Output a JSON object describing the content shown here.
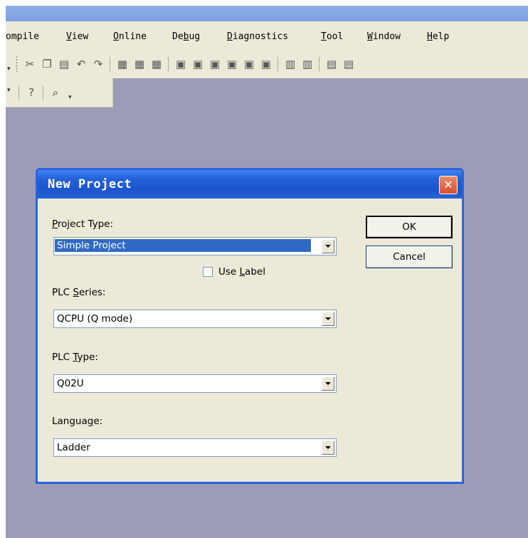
{
  "menubar": {
    "items": [
      {
        "pre": "",
        "mn": "",
        "post": "ompile"
      },
      {
        "pre": "",
        "mn": "V",
        "post": "iew"
      },
      {
        "pre": "",
        "mn": "O",
        "post": "nline"
      },
      {
        "pre": "De",
        "mn": "b",
        "post": "ug"
      },
      {
        "pre": "",
        "mn": "D",
        "post": "iagnostics"
      },
      {
        "pre": "",
        "mn": "T",
        "post": "ool"
      },
      {
        "pre": "",
        "mn": "W",
        "post": "indow"
      },
      {
        "pre": "",
        "mn": "H",
        "post": "elp"
      }
    ]
  },
  "toolbar": {
    "icons": [
      "cut-icon",
      "copy-icon",
      "paste-icon",
      "undo-icon",
      "redo-icon",
      "search-icon"
    ],
    "chevron": "▾"
  },
  "dialog": {
    "title": "New Project",
    "close_glyph": "✕",
    "project_type_label": {
      "mn": "P",
      "rest": "roject Type:"
    },
    "project_type_value": "Simple Project",
    "use_label": {
      "pre": "Use ",
      "mn": "L",
      "rest": "abel"
    },
    "plc_series_label": {
      "pre": "PLC ",
      "mn": "S",
      "rest": "eries:"
    },
    "plc_series_value": "QCPU (Q mode)",
    "plc_type_label": {
      "pre": "PLC ",
      "mn": "T",
      "rest": "ype:"
    },
    "plc_type_value": "Q02U",
    "language_label": {
      "pre": "Langua",
      "mn": "g",
      "rest": "e:"
    },
    "language_value": "Ladder",
    "ok_label": "OK",
    "cancel_label": "Cancel"
  },
  "colors": {
    "dialog_title_bg": "#2362d9",
    "workspace_bg": "#9c9cb6",
    "selection": "#316ac5"
  }
}
